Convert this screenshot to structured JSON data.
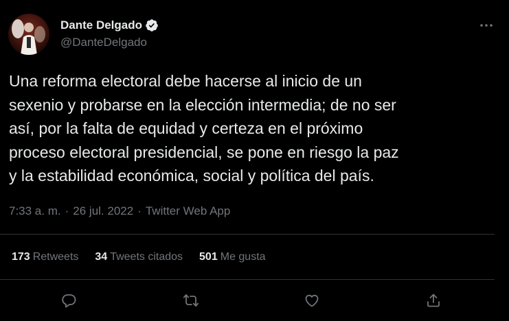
{
  "colors": {
    "background": "#000000",
    "text_primary": "#e7e9ea",
    "text_secondary": "#71767b",
    "divider": "#2f3336",
    "verified_badge": "#e7e9ea"
  },
  "author": {
    "display_name": "Dante Delgado",
    "handle": "@DanteDelgado",
    "verified": true,
    "avatar_icon": "profile-photo"
  },
  "tweet": {
    "text": "Una reforma electoral debe hacerse al inicio de un\nsexenio y probarse en la elección intermedia; de no ser\nasí, por la falta de equidad y certeza en el próximo\nproceso electoral presidencial, se pone en riesgo la paz\ny la estabilidad económica, social y política del país.",
    "time": "7:33 a. m.",
    "separator": "·",
    "date": "26 jul. 2022",
    "source": "Twitter Web App"
  },
  "stats": {
    "retweets_count": "173",
    "retweets_label": "Retweets",
    "quotes_count": "34",
    "quotes_label": "Tweets citados",
    "likes_count": "501",
    "likes_label": "Me gusta"
  },
  "icons": {
    "more": "more-dots-icon",
    "reply": "reply-icon",
    "retweet": "retweet-icon",
    "like": "heart-icon",
    "share": "share-icon"
  }
}
